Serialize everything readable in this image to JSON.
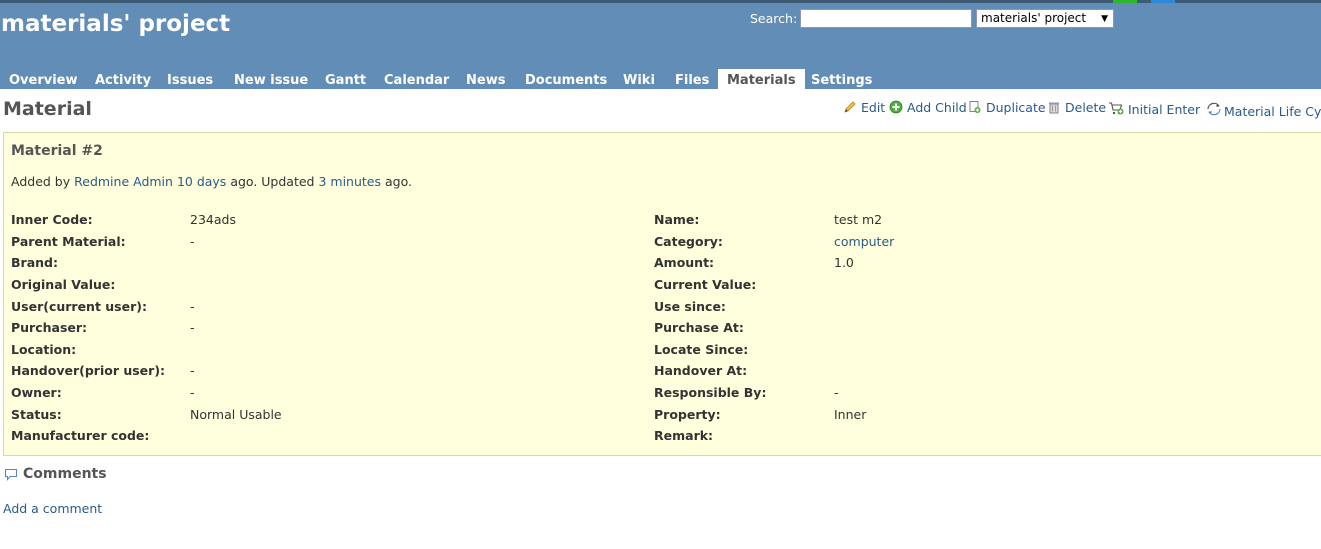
{
  "header": {
    "project_title": "materials' project",
    "search_label": "Search:",
    "search_value": "",
    "project_select_value": "materials' project"
  },
  "menu": {
    "tabs": [
      {
        "label": "Overview"
      },
      {
        "label": "Activity"
      },
      {
        "label": "Issues"
      },
      {
        "label": "New issue"
      },
      {
        "label": "Gantt"
      },
      {
        "label": "Calendar"
      },
      {
        "label": "News"
      },
      {
        "label": "Documents"
      },
      {
        "label": "Wiki"
      },
      {
        "label": "Files"
      },
      {
        "label": "Materials",
        "selected": true
      },
      {
        "label": "Settings"
      }
    ]
  },
  "page": {
    "heading": "Material",
    "actions": {
      "edit": "Edit",
      "add_child": "Add Child",
      "duplicate": "Duplicate",
      "delete": "Delete",
      "initial_enter": "Initial Enter",
      "life_cycle": "Material Life Cyc"
    },
    "icons": {
      "edit": "pencil-icon",
      "add_child": "add-green-circle-icon",
      "duplicate": "copy-icon",
      "delete": "trash-icon",
      "initial_enter": "cart-add-icon",
      "life_cycle": "cycle-icon",
      "comments": "speech-bubble-icon"
    }
  },
  "material": {
    "subject": "Material #2",
    "author_prefix": "Added by",
    "author": "Redmine Admin",
    "created_ago": "10 days",
    "middle_text": "ago. Updated",
    "updated_ago": "3 minutes",
    "suffix": "ago.",
    "left_attributes": [
      {
        "label": "Inner Code:",
        "value": "234ads"
      },
      {
        "label": "Parent Material:",
        "value": "-"
      },
      {
        "label": "Brand:",
        "value": ""
      },
      {
        "label": "Original Value:",
        "value": ""
      },
      {
        "label": "User(current user):",
        "value": "-"
      },
      {
        "label": "Purchaser:",
        "value": "-"
      },
      {
        "label": "Location:",
        "value": ""
      },
      {
        "label": "Handover(prior user):",
        "value": "-"
      },
      {
        "label": "Owner:",
        "value": "-"
      },
      {
        "label": "Status:",
        "value": "Normal Usable"
      },
      {
        "label": "Manufacturer code:",
        "value": ""
      }
    ],
    "right_attributes": [
      {
        "label": "Name:",
        "value": "test m2"
      },
      {
        "label": "Category:",
        "value": "computer",
        "link": true
      },
      {
        "label": "Amount:",
        "value": "1.0"
      },
      {
        "label": "Current Value:",
        "value": ""
      },
      {
        "label": "Use since:",
        "value": ""
      },
      {
        "label": "Purchase At:",
        "value": ""
      },
      {
        "label": "Locate Since:",
        "value": ""
      },
      {
        "label": "Handover At:",
        "value": ""
      },
      {
        "label": "Responsible By:",
        "value": "-"
      },
      {
        "label": "Property:",
        "value": "Inner"
      },
      {
        "label": "Remark:",
        "value": ""
      }
    ]
  },
  "comments": {
    "title": "Comments",
    "add_link": "Add a comment"
  },
  "colors": {
    "header_bg": "#628db6",
    "box_bg": "#ffffdd",
    "link": "#2a5a8a"
  }
}
